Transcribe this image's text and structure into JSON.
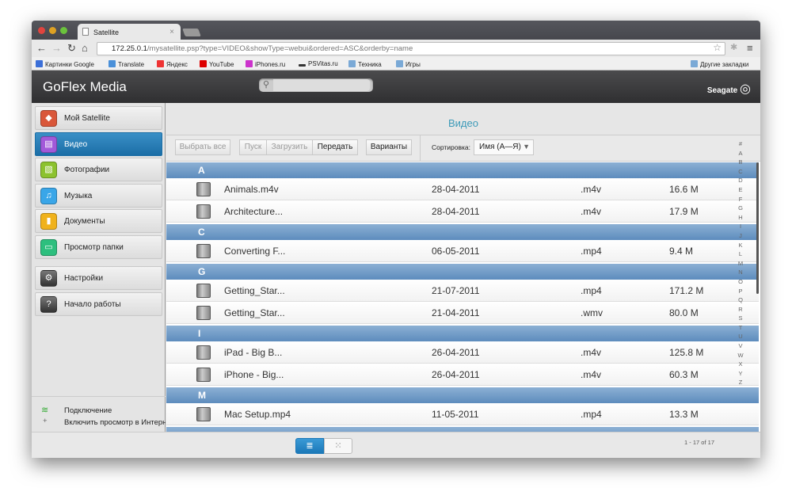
{
  "browser": {
    "tab_title": "Satellite",
    "url_host": "172.25.0.1",
    "url_path": "/mysatellite.psp?type=VIDEO&showType=webui&ordered=ASC&orderby=name",
    "bookmarks": [
      "Картинки Google",
      "Translate",
      "Яндекс",
      "YouTube",
      "iPhones.ru",
      "PSVitas.ru",
      "Техника",
      "Игры"
    ],
    "other_bookmarks": "Другие закладки"
  },
  "app": {
    "title": "GoFlex Media",
    "brand": "Seagate",
    "search_placeholder": ""
  },
  "sidebar": {
    "items": [
      {
        "label": "Мой Satellite",
        "icon": "satellite-icon",
        "color": "#d9573a"
      },
      {
        "label": "Видео",
        "icon": "video-icon",
        "color": "#a259d9",
        "active": true
      },
      {
        "label": "Фотографии",
        "icon": "photos-icon",
        "color": "#8cc22e"
      },
      {
        "label": "Музыка",
        "icon": "music-icon",
        "color": "#3aa6e8"
      },
      {
        "label": "Документы",
        "icon": "documents-icon",
        "color": "#f0b21c"
      },
      {
        "label": "Просмотр папки",
        "icon": "folder-icon",
        "color": "#2dbf7e"
      }
    ],
    "settings": [
      {
        "label": "Настройки",
        "icon": "gear-icon"
      },
      {
        "label": "Начало работы",
        "icon": "help-icon"
      }
    ],
    "connection": "Подключение",
    "enable_internet": "Включить просмотр в Интернете"
  },
  "main": {
    "title": "Видео",
    "toolbar": {
      "select_all": "Выбрать все",
      "play": "Пуск",
      "download": "Загрузить",
      "transfer": "Передать",
      "options": "Варианты",
      "sort_label": "Сортировка:",
      "sort_value": "Имя (А—Я)"
    },
    "groups": [
      {
        "letter": "A",
        "files": [
          {
            "name": "Animals.m4v",
            "date": "28-04-2011",
            "ext": ".m4v",
            "size": "16.6 M"
          },
          {
            "name": "Architecture...",
            "date": "28-04-2011",
            "ext": ".m4v",
            "size": "17.9 M"
          }
        ]
      },
      {
        "letter": "C",
        "files": [
          {
            "name": "Converting F...",
            "date": "06-05-2011",
            "ext": ".mp4",
            "size": "9.4 M"
          }
        ]
      },
      {
        "letter": "G",
        "files": [
          {
            "name": "Getting_Star...",
            "date": "21-07-2011",
            "ext": ".mp4",
            "size": "171.2 M"
          },
          {
            "name": "Getting_Star...",
            "date": "21-04-2011",
            "ext": ".wmv",
            "size": "80.0 M"
          }
        ]
      },
      {
        "letter": "I",
        "files": [
          {
            "name": "iPad - Big B...",
            "date": "26-04-2011",
            "ext": ".m4v",
            "size": "125.8 M"
          },
          {
            "name": "iPhone - Big...",
            "date": "26-04-2011",
            "ext": ".m4v",
            "size": "60.3 M"
          }
        ]
      },
      {
        "letter": "M",
        "files": [
          {
            "name": "Mac Setup.mp4",
            "date": "11-05-2011",
            "ext": ".mp4",
            "size": "13.3 M"
          }
        ]
      }
    ],
    "alphabet": [
      "#",
      "A",
      "B",
      "C",
      "D",
      "E",
      "F",
      "G",
      "H",
      "I",
      "J",
      "K",
      "L",
      "M",
      "N",
      "O",
      "P",
      "Q",
      "R",
      "S",
      "T",
      "U",
      "V",
      "W",
      "X",
      "Y",
      "Z"
    ],
    "count": "1 - 17 of 17",
    "view_mode": "list"
  },
  "colors": {
    "accent": "#1b6ea6",
    "group_header": "#6f9ac6",
    "title": "#3c9ab8"
  }
}
